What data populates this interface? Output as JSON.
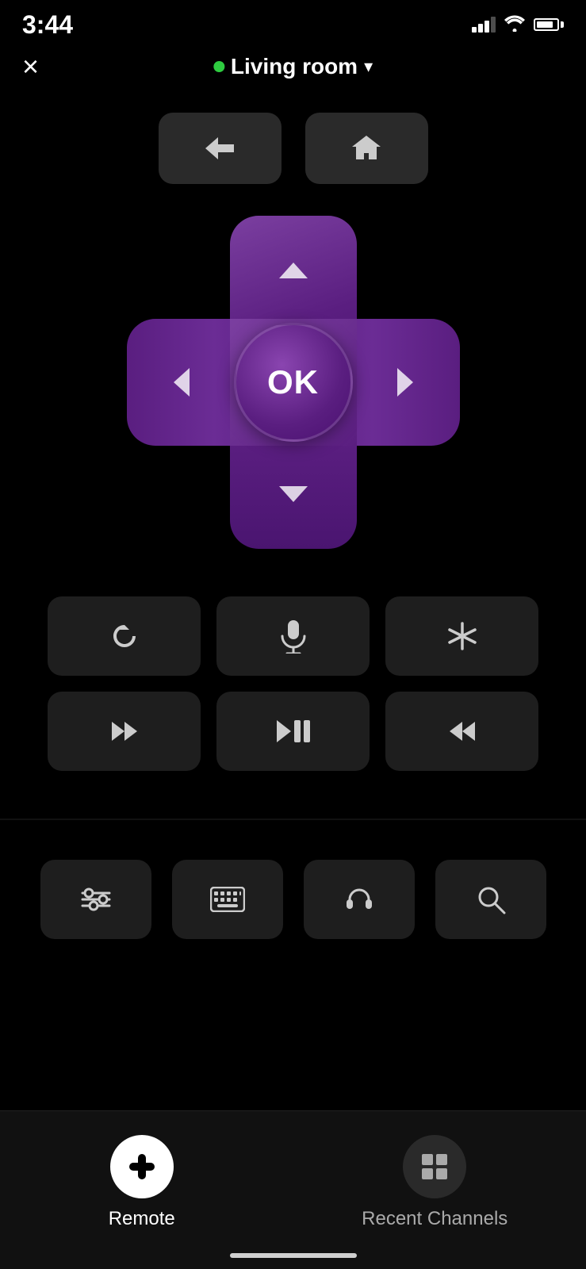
{
  "statusBar": {
    "time": "3:44",
    "signalBars": [
      4,
      8,
      12,
      16
    ],
    "batteryPercent": 85
  },
  "header": {
    "closeLabel": "×",
    "deviceName": "Living room",
    "deviceOnline": true,
    "dropdownArrow": "▾"
  },
  "navButtons": {
    "back": "←",
    "home": "⌂"
  },
  "dpad": {
    "upArrow": "^",
    "downArrow": "v",
    "leftArrow": "<",
    "rightArrow": ">",
    "okLabel": "OK"
  },
  "mediaControls": {
    "row1": [
      {
        "id": "replay",
        "icon": "↺"
      },
      {
        "id": "mic",
        "icon": "🎙"
      },
      {
        "id": "asterisk",
        "icon": "✱"
      }
    ],
    "row2": [
      {
        "id": "rewind",
        "icon": "⏮"
      },
      {
        "id": "play-pause",
        "icon": "⏯"
      },
      {
        "id": "fast-forward",
        "icon": "⏭"
      }
    ]
  },
  "toolButtons": [
    {
      "id": "settings",
      "icon": "⚙"
    },
    {
      "id": "keyboard",
      "icon": "⌨"
    },
    {
      "id": "headphones",
      "icon": "🎧"
    },
    {
      "id": "search",
      "icon": "🔍"
    }
  ],
  "tabs": [
    {
      "id": "remote",
      "label": "Remote",
      "icon": "🎮",
      "active": true
    },
    {
      "id": "recent-channels",
      "label": "Recent Channels",
      "icon": "⊞",
      "active": false
    }
  ]
}
